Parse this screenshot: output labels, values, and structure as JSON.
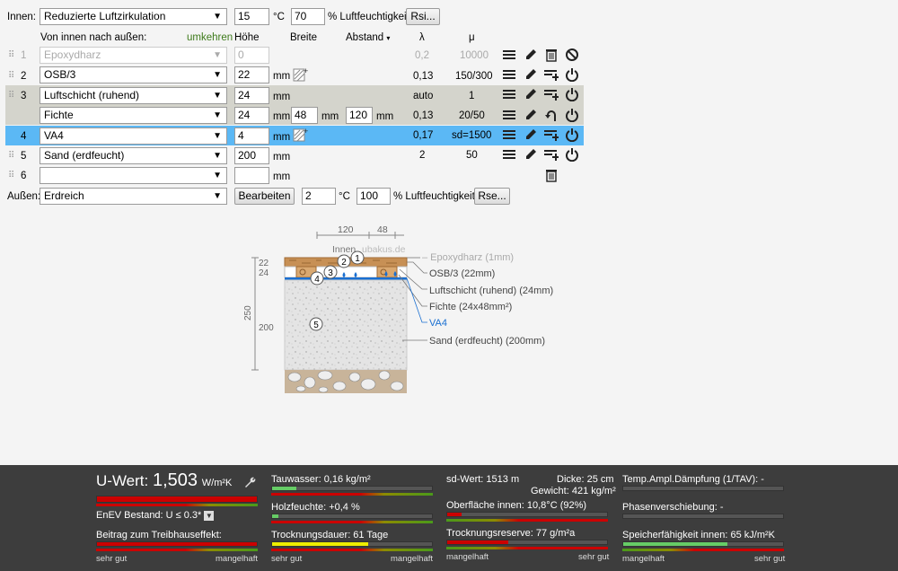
{
  "inside": {
    "label": "Innen:",
    "condition": "Reduzierte Luftzirkulation",
    "temp": "15",
    "temp_unit": "°C",
    "humidity": "70",
    "humidity_unit": "% Luftfeuchtigkeit",
    "rsi_button": "Rsi..."
  },
  "header": {
    "direction": "Von innen nach außen:",
    "reverse": "umkehren",
    "thickness": "Höhe",
    "width": "Breite",
    "spacing": "Abstand",
    "spacing_arrow": "▾",
    "lambda": "λ",
    "mu": "μ"
  },
  "layers": [
    {
      "num": "1",
      "material": "Epoxydharz",
      "thickness": "0",
      "unit": "",
      "lambda": "0,2",
      "mu": "10000"
    },
    {
      "num": "2",
      "material": "OSB/3",
      "thickness": "22",
      "unit": "mm",
      "lambda": "0,13",
      "mu": "150/300"
    },
    {
      "num": "3",
      "material": "Luftschicht (ruhend)",
      "thickness": "24",
      "unit": "mm",
      "lambda": "auto",
      "mu": "1"
    },
    {
      "num": "",
      "material": "Fichte",
      "thickness": "24",
      "unit": "mm",
      "width": "48",
      "width_unit": "mm",
      "spacing": "120",
      "spacing_unit": "mm",
      "lambda": "0,13",
      "mu": "20/50"
    },
    {
      "num": "4",
      "material": "VA4",
      "thickness": "4",
      "unit": "mm",
      "lambda": "0,17",
      "mu": "sd=1500"
    },
    {
      "num": "5",
      "material": "Sand (erdfeucht)",
      "thickness": "200",
      "unit": "mm",
      "lambda": "2",
      "mu": "50"
    },
    {
      "num": "6",
      "material": "",
      "thickness": "",
      "unit": "mm",
      "lambda": "",
      "mu": ""
    }
  ],
  "outside": {
    "label": "Außen:",
    "condition": "Erdreich",
    "edit_button": "Bearbeiten",
    "temp": "2",
    "temp_unit": "°C",
    "humidity": "100",
    "humidity_unit": "% Luftfeuchtigkeit",
    "rse_button": "Rse..."
  },
  "diagram": {
    "top_dims": [
      "120",
      "48"
    ],
    "inside_label": "Innen",
    "watermark": "ubakus.de",
    "left_dims": [
      "22",
      "24",
      "250",
      "200"
    ],
    "legend": [
      "– Epoxydharz (1mm)",
      "OSB/3 (22mm)",
      "Luftschicht (ruhend) (24mm)",
      "Fichte (24x48mm²)",
      "VA4",
      "Sand (erdfeucht) (200mm)"
    ],
    "markers": [
      "1",
      "2",
      "3",
      "4",
      "5"
    ],
    "highlight_color": "#1a6fd1"
  },
  "footer": {
    "uwert_label": "U-Wert:",
    "uwert_value": "1,503",
    "uwert_unit": "W/m²K",
    "enev": "EnEV Bestand: U ≤ 0.3*",
    "greenhouse": "Beitrag zum Treibhauseffekt:",
    "tauwasser": "Tauwasser: 0,16 kg/m²",
    "holz": "Holzfeuchte: +0,4 %",
    "trocknung": "Trocknungsdauer: 61 Tage",
    "sd": "sd-Wert: 1513 m",
    "dicke": "Dicke: 25 cm",
    "gewicht": "Gewicht: 421 kg/m²",
    "oberflaeche": "Oberfläche innen: 10,8°C (92%)",
    "reserve": "Trocknungsreserve: 77 g/m²a",
    "temp_ampl": "Temp.Ampl.Dämpfung (1/TAV): -",
    "phase": "Phasenverschiebung: -",
    "speicher": "Speicherfähigkeit innen: 65 kJ/m²K",
    "good": "sehr gut",
    "bad": "mangelhaft"
  }
}
